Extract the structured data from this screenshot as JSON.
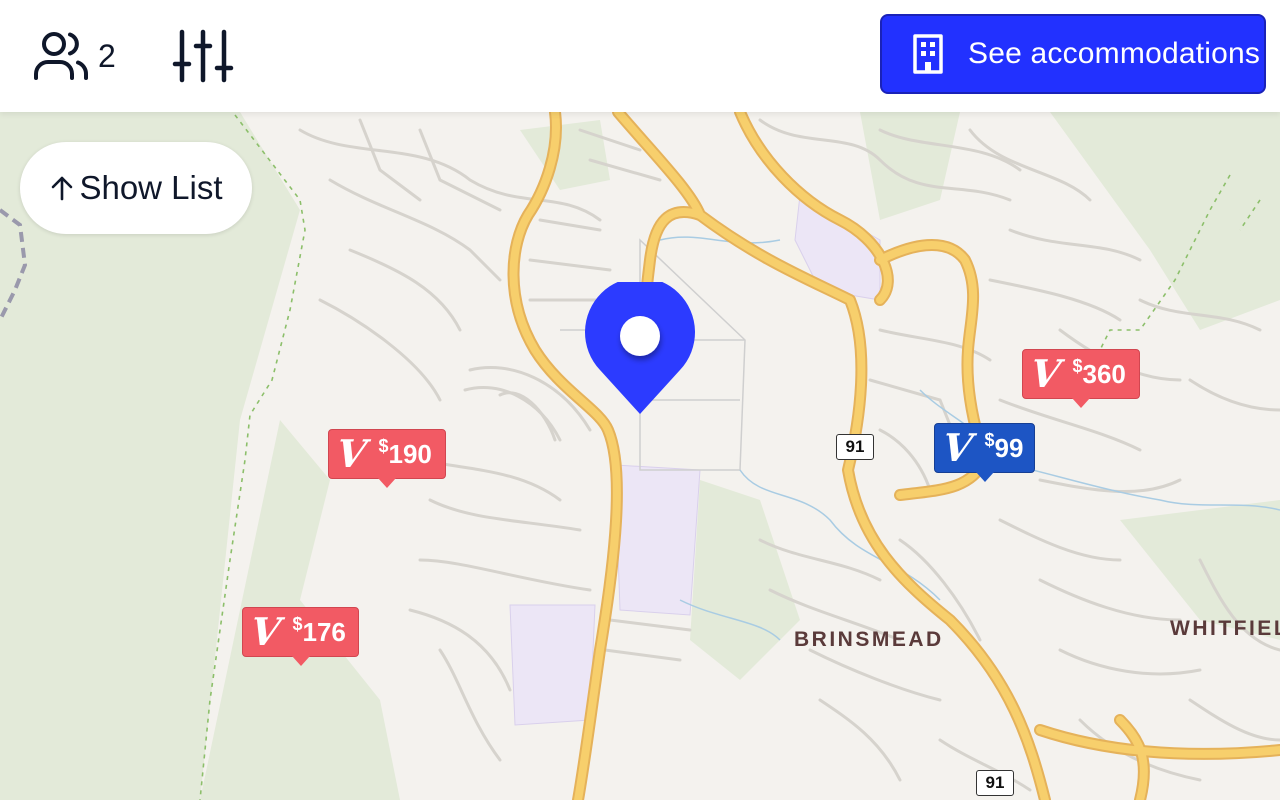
{
  "header": {
    "guests_icon": "users-icon",
    "guest_count": "2",
    "filters_icon": "sliders-icon",
    "accommodations_button": {
      "icon": "building-icon",
      "label": "See accommodations",
      "color": "#2231ff"
    }
  },
  "map": {
    "show_list_label": "Show List",
    "show_list_icon": "arrow-up-icon",
    "route_shields": [
      "91",
      "91"
    ],
    "suburbs": [
      "BRINSMEAD",
      "WHITFIEL"
    ],
    "selected_location_icon": "map-pin-icon",
    "selected_location_color": "#2c3bff",
    "listings": [
      {
        "logo": "V",
        "currency": "$",
        "price": "190",
        "selected": false
      },
      {
        "logo": "V",
        "currency": "$",
        "price": "176",
        "selected": false
      },
      {
        "logo": "V",
        "currency": "$",
        "price": "99",
        "selected": true
      },
      {
        "logo": "V",
        "currency": "$",
        "price": "360",
        "selected": false
      }
    ],
    "colors": {
      "listing": "#f25a64",
      "listing_selected": "#1d55c4",
      "major_road": "#f7cf6c"
    }
  }
}
